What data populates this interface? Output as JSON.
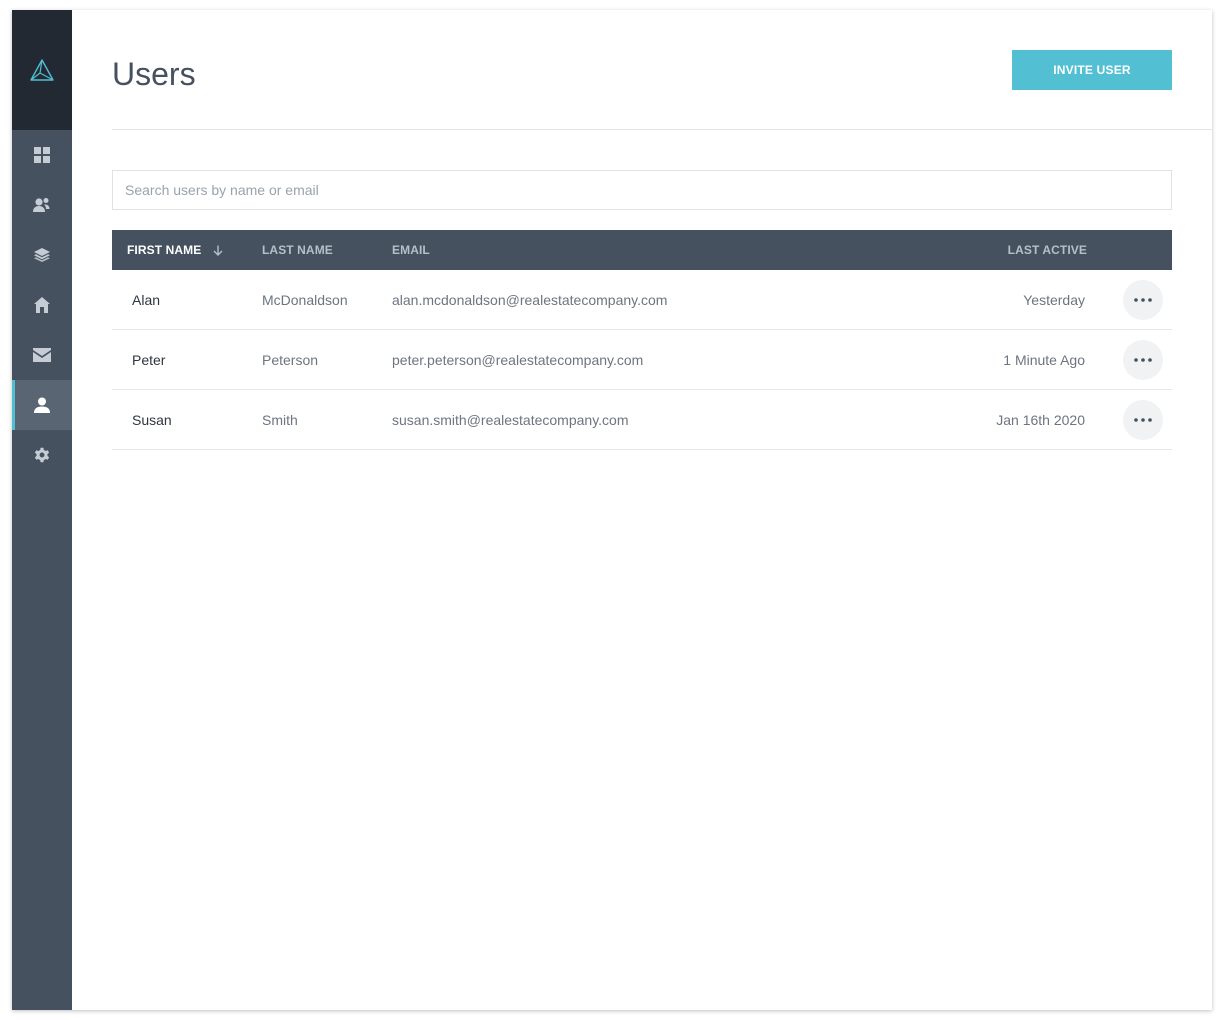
{
  "header": {
    "title": "Users",
    "invite_label": "INVITE USER"
  },
  "search": {
    "placeholder": "Search users by name or email",
    "value": ""
  },
  "sidebar": {
    "items": [
      {
        "name": "dashboard",
        "icon": "grid-icon"
      },
      {
        "name": "contacts",
        "icon": "contacts-icon"
      },
      {
        "name": "layers",
        "icon": "layers-icon"
      },
      {
        "name": "properties",
        "icon": "home-icon"
      },
      {
        "name": "mail",
        "icon": "mail-icon"
      },
      {
        "name": "users",
        "icon": "user-icon",
        "active": true
      },
      {
        "name": "settings",
        "icon": "gear-icon"
      }
    ]
  },
  "table": {
    "columns": {
      "first_name": "FIRST NAME",
      "last_name": "LAST NAME",
      "email": "EMAIL",
      "last_active": "LAST ACTIVE"
    },
    "rows": [
      {
        "first": "Alan",
        "last": "McDonaldson",
        "email": "alan.mcdonaldson@realestatecompany.com",
        "active": "Yesterday"
      },
      {
        "first": "Peter",
        "last": "Peterson",
        "email": "peter.peterson@realestatecompany.com",
        "active": "1 Minute Ago"
      },
      {
        "first": "Susan",
        "last": "Smith",
        "email": "susan.smith@realestatecompany.com",
        "active": "Jan 16th 2020"
      }
    ]
  },
  "colors": {
    "sidebar": "#465160",
    "sidebar_logo": "#232933",
    "accent": "#52bfd3",
    "table_header": "#465160"
  }
}
